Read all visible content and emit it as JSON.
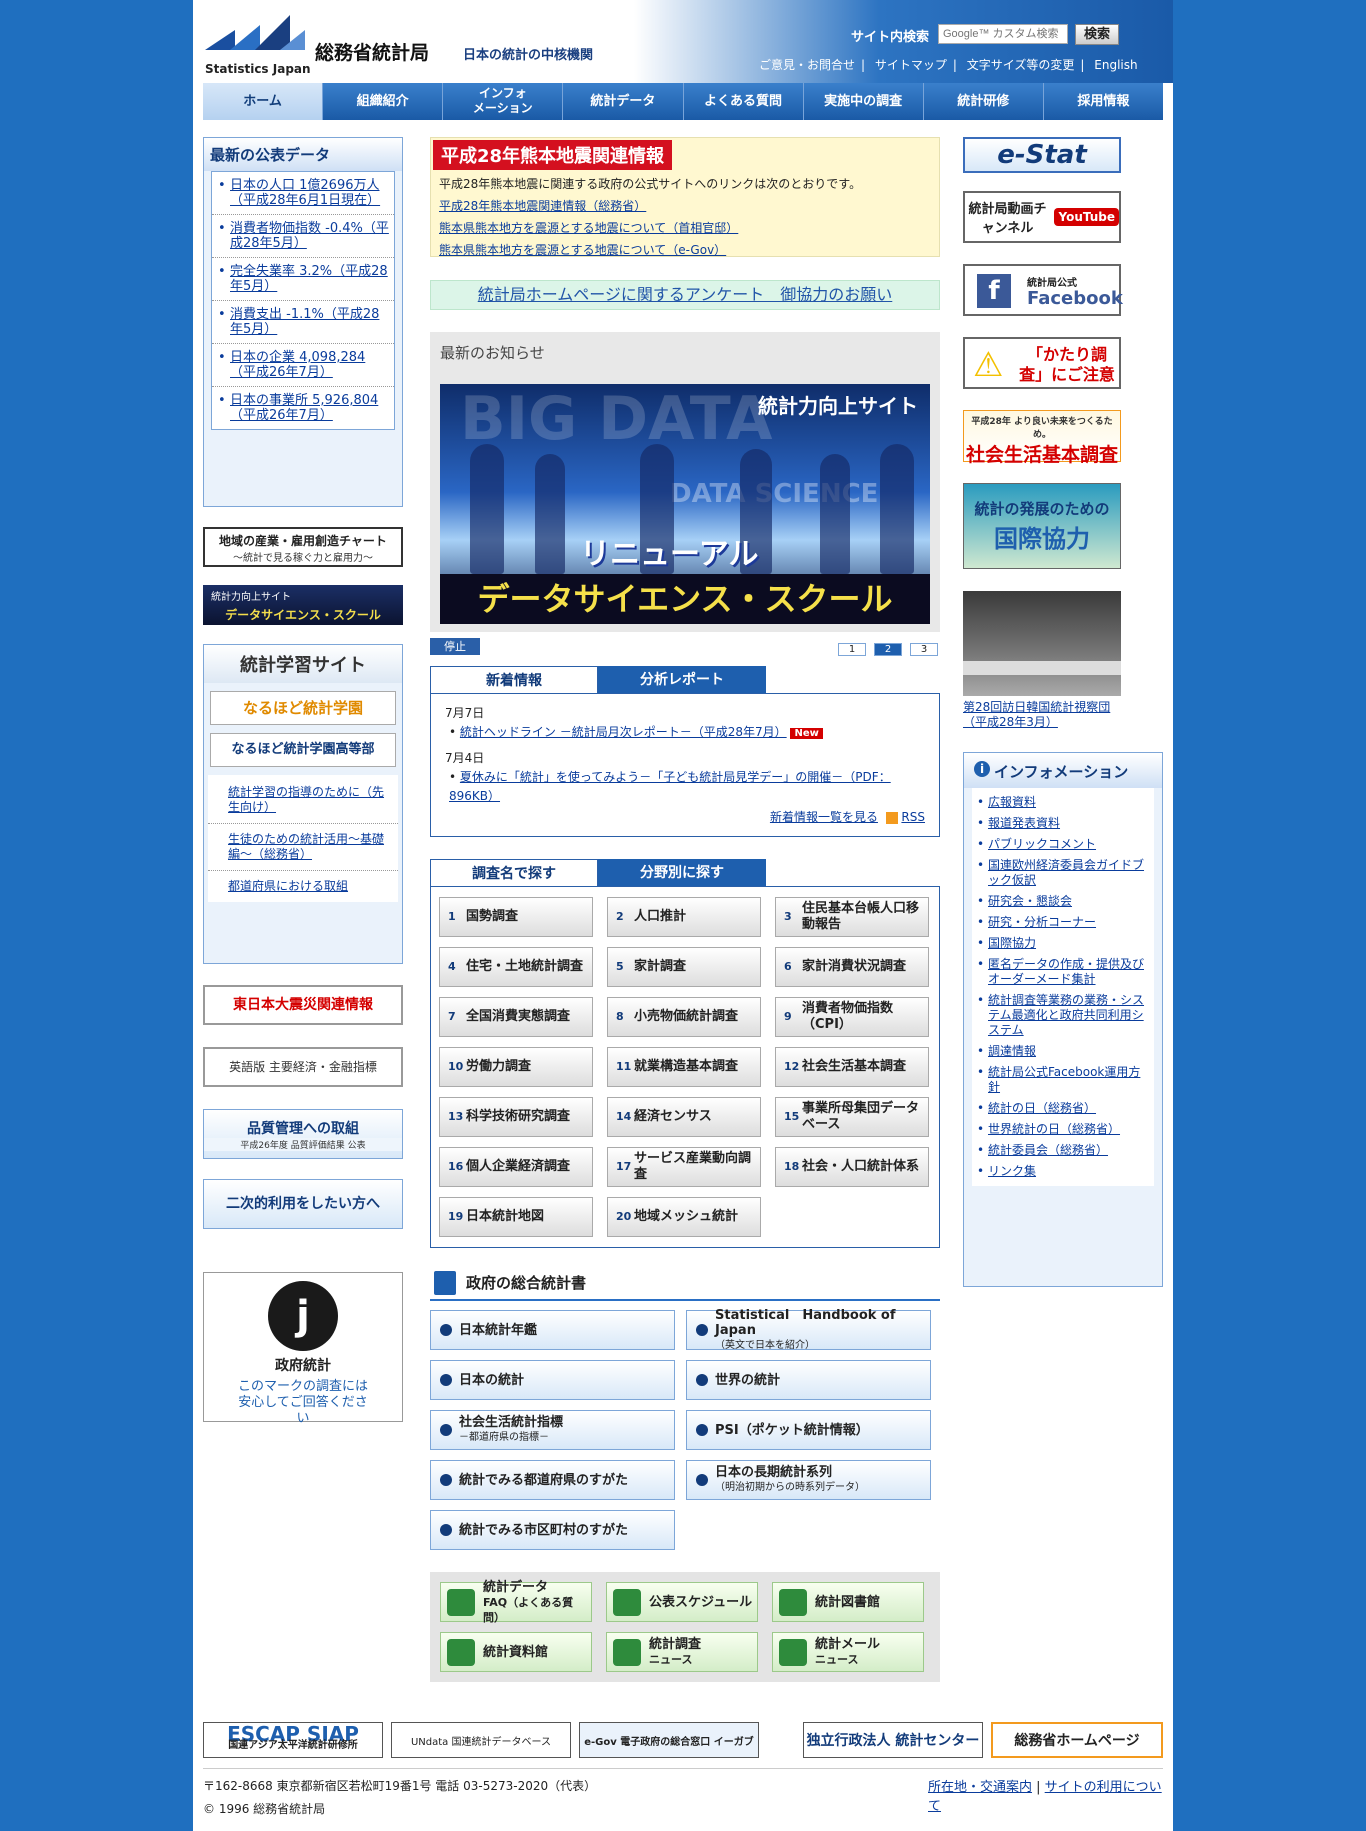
{
  "header": {
    "logo_en": "Statistics Japan",
    "logo_jp": "総務省統計局",
    "tagline": "日本の統計の中核機関",
    "search_label": "サイト内検索",
    "search_placeholder": "Google™ カスタム検索",
    "search_button": "検索",
    "links": [
      "ご意見・お問合せ",
      "サイトマップ",
      "文字サイズ等の変更",
      "English"
    ]
  },
  "nav": [
    "ホーム",
    "組織紹介",
    "インフォ\nメーション",
    "統計データ",
    "よくある質問",
    "実施中の調査",
    "統計研修",
    "採用情報"
  ],
  "latest_data": {
    "title": "最新の公表データ",
    "items": [
      "日本の人口 1億2696万人（平成28年6月1日現在）",
      "消費者物価指数 -0.4%（平成28年5月）",
      "完全失業率 3.2%（平成28年5月）",
      "消費支出 -1.1%（平成28年5月）",
      "日本の企業 4,098,284（平成26年7月）",
      "日本の事業所 5,926,804（平成26年7月）"
    ]
  },
  "left_banners": {
    "chart_title": "地域の産業・雇用創造チャート",
    "chart_sub": "～統計で見る稼ぐ力と雇用力～",
    "ds_school_top": "統計力向上サイト",
    "ds_school": "データサイエンス・スクール",
    "learning_title": "統計学習サイト",
    "naruhodo": "なるほど統計学園",
    "naruhodo_high": "なるほど統計学園高等部",
    "learning_links": [
      "統計学習の指導のために（先生向け）",
      "生徒のための統計活用～基礎編～（総務省）",
      "都道府県における取組"
    ],
    "earthquake": "東日本大震災関連情報",
    "english_indicators": "英語版 主要経済・金融指標",
    "quality": "品質管理への取組",
    "quality_sub": "平成26年度 品質評価結果 公表",
    "secondary": "二次的利用をしたい方へ",
    "gov_stats": "政府統計",
    "gov_stats_note": "このマークの調査には安心してご回答ください"
  },
  "kumamoto": {
    "title": "平成28年熊本地震関連情報",
    "intro": "平成28年熊本地震に関連する政府の公式サイトへのリンクは次のとおりです。",
    "links": [
      "平成28年熊本地震関連情報（総務省）",
      "熊本県熊本地方を震源とする地震について（首相官邸）",
      "熊本県熊本地方を震源とする地震について（e-Gov）"
    ]
  },
  "survey_request": "統計局ホームページに関するアンケート　御協力のお願い",
  "news": {
    "heading": "最新のお知らせ",
    "hero_top": "統計力向上サイト",
    "hero_renew": "リニューアル",
    "hero_school": "データサイエンス・スクール",
    "hero_bg": "DATA SCIENCE",
    "stop": "停止",
    "pages": [
      "1",
      "2",
      "3"
    ]
  },
  "tabs1": [
    "新着情報",
    "分析レポート"
  ],
  "whats_new": {
    "date1": "7月7日",
    "item1": "統計ヘッドライン －統計局月次レポート－（平成28年7月）",
    "badge": "New",
    "date2": "7月4日",
    "item2": "夏休みに「統計」を使ってみよう－「子ども統計局見学デー」の開催－（PDF：896KB）",
    "list_link": "新着情報一覧を見る",
    "rss": "RSS"
  },
  "tabs2": [
    "調査名で探す",
    "分野別に探す"
  ],
  "surveys": [
    {
      "n": "1",
      "label": "国勢調査"
    },
    {
      "n": "2",
      "label": "人口推計"
    },
    {
      "n": "3",
      "label": "住民基本台帳人口移動報告"
    },
    {
      "n": "4",
      "label": "住宅・土地統計調査"
    },
    {
      "n": "5",
      "label": "家計調査"
    },
    {
      "n": "6",
      "label": "家計消費状況調査"
    },
    {
      "n": "7",
      "label": "全国消費実態調査"
    },
    {
      "n": "8",
      "label": "小売物価統計調査"
    },
    {
      "n": "9",
      "label": "消費者物価指数（CPI）"
    },
    {
      "n": "10",
      "label": "労働力調査"
    },
    {
      "n": "11",
      "label": "就業構造基本調査"
    },
    {
      "n": "12",
      "label": "社会生活基本調査"
    },
    {
      "n": "13",
      "label": "科学技術研究調査"
    },
    {
      "n": "14",
      "label": "経済センサス"
    },
    {
      "n": "15",
      "label": "事業所母集団データベース"
    },
    {
      "n": "16",
      "label": "個人企業経済調査"
    },
    {
      "n": "17",
      "label": "サービス産業動向調査"
    },
    {
      "n": "18",
      "label": "社会・人口統計体系"
    },
    {
      "n": "19",
      "label": "日本統計地図"
    },
    {
      "n": "20",
      "label": "地域メッシュ統計"
    }
  ],
  "gov_books": {
    "title": "政府の総合統計書",
    "items": [
      {
        "label": "日本統計年鑑",
        "sub": ""
      },
      {
        "label": "Statistical　Handbook of Japan",
        "sub": "（英文で日本を紹介）"
      },
      {
        "label": "日本の統計",
        "sub": ""
      },
      {
        "label": "世界の統計",
        "sub": ""
      },
      {
        "label": "社会生活統計指標",
        "sub": "－都道府県の指標－"
      },
      {
        "label": "PSI（ポケット統計情報）",
        "sub": ""
      },
      {
        "label": "統計でみる都道府県のすがた",
        "sub": ""
      },
      {
        "label": "日本の長期統計系列",
        "sub": "（明治初期からの時系列データ）"
      },
      {
        "label": "統計でみる市区町村のすがた",
        "sub": ""
      }
    ]
  },
  "bottom_buttons": [
    {
      "label": "統計データ",
      "sub": "FAQ（よくある質問）"
    },
    {
      "label": "公表スケジュール",
      "sub": ""
    },
    {
      "label": "統計図書館",
      "sub": ""
    },
    {
      "label": "統計資料館",
      "sub": ""
    },
    {
      "label": "統計調査",
      "sub": "ニュース"
    },
    {
      "label": "統計メール",
      "sub": "ニュース"
    }
  ],
  "right": {
    "estat": "e-Stat",
    "youtube": "統計局動画チャンネル",
    "youtube_logo": "YouTube",
    "facebook_top": "統計局公式",
    "facebook": "Facebook",
    "katari": "「かたり調査」にご注意",
    "shakai_top": "平成28年 より良い未来をつくるため。",
    "shakai": "社会生活基本調査",
    "intl_top": "統計の発展のための",
    "intl": "国際協力",
    "photo_caption": "第28回訪日韓国統計視察団（平成28年3月）"
  },
  "info": {
    "title": "インフォメーション",
    "items": [
      "広報資料",
      "報道発表資料",
      "パブリックコメント",
      "国連欧州経済委員会ガイドブック仮訳",
      "研究会・懇談会",
      "研究・分析コーナー",
      "国際協力",
      "匿名データの作成・提供及びオーダーメード集計",
      "統計調査等業務の業務・システム最適化と政府共同利用システム",
      "調達情報",
      "統計局公式Facebook運用方針",
      "統計の日（総務省）",
      "世界統計の日（総務省）",
      "統計委員会（総務省）",
      "リンク集"
    ]
  },
  "footer": {
    "logos": [
      "ESCAP SIAP",
      "国連アジア太平洋統計研修所",
      "UNdata 国連統計データベース",
      "e-Gov 電子政府の総合窓口 イーガブ",
      "独立行政法人 統計センター",
      "総務省ホームページ"
    ],
    "address": "〒162-8668 東京都新宿区若松町19番1号 電話 03-5273-2020（代表）",
    "copyright": "© 1996 総務省統計局",
    "links": [
      "所在地・交通案内",
      "サイトの利用について"
    ]
  }
}
